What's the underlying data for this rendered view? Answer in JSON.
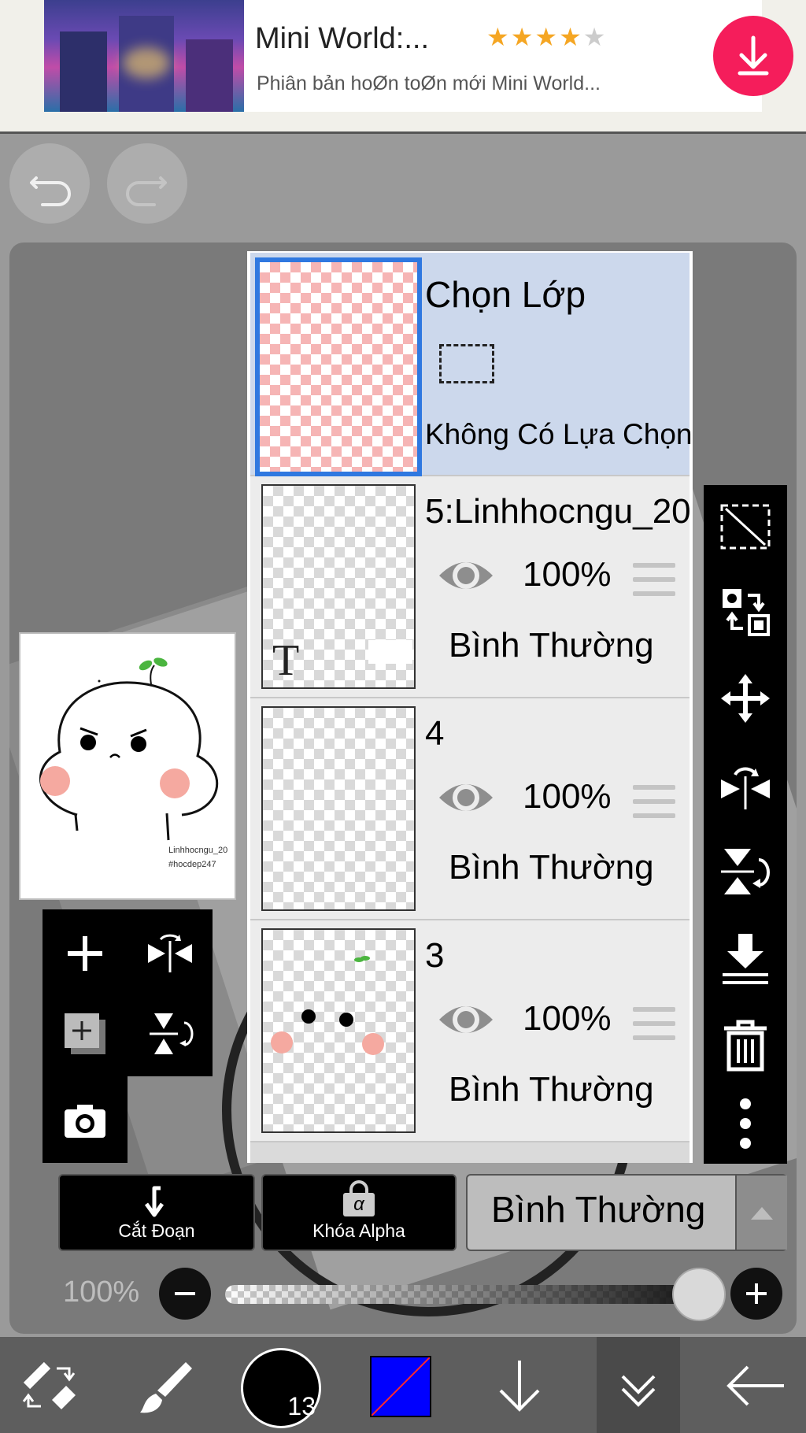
{
  "ad": {
    "title": "Mini World:...",
    "rating": 4,
    "stars_on": "★★★★",
    "stars_off": "★",
    "subtitle": "Phiân bản hoØn toØn mới Mini World...",
    "download_icon": "download-icon",
    "accent": "#f51d5b"
  },
  "history": {
    "undo_icon": "undo-icon",
    "redo_icon": "redo-icon"
  },
  "preview": {
    "watermark_line1": "Linhhocngu_20",
    "watermark_line2": "#hocdep247"
  },
  "layers": {
    "selection": {
      "title": "Chọn Lớp",
      "status": "Không Có Lựa Chọn"
    },
    "items": [
      {
        "name": "5:Linhhocngu_20",
        "opacity": "100%",
        "blend": "Bình Thường",
        "type": "text"
      },
      {
        "name": "4",
        "opacity": "100%",
        "blend": "Bình Thường",
        "type": "raster"
      },
      {
        "name": "3",
        "opacity": "100%",
        "blend": "Bình Thường",
        "type": "raster"
      }
    ]
  },
  "left_tools": [
    "add-layer-icon",
    "flip-horizontal-icon",
    "add-copy-icon",
    "flip-vertical-icon",
    "camera-icon"
  ],
  "right_tools": [
    "clear-selection-icon",
    "swap-icon",
    "move-icon",
    "rotate-flip-icon",
    "flip-vertical-rotate-icon",
    "merge-down-icon",
    "delete-icon",
    "more-icon"
  ],
  "bottom": {
    "clip_label": "Cắt Đoạn",
    "alpha_lock_label": "Khóa Alpha",
    "alpha_symbol": "α",
    "blend_mode": "Bình Thường",
    "opacity_label": "100%",
    "opacity_value": 100
  },
  "toolbar": {
    "brush_size": "13",
    "current_color": "#0000ff",
    "icons": [
      "transform-tools-icon",
      "brush-icon",
      "brush-size-indicator",
      "color-swatch",
      "layer-down-icon",
      "collapse-icon",
      "back-icon"
    ]
  }
}
